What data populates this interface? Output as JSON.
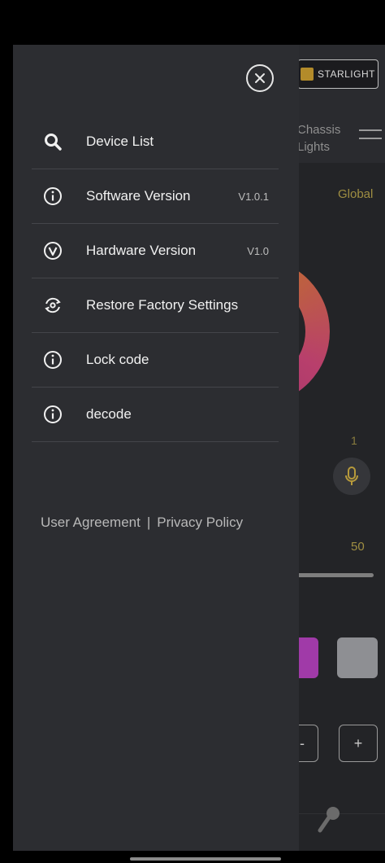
{
  "background_app": {
    "brand_label": "STARLIGHT",
    "tab_label_line1": "Chassis",
    "tab_label_line2": "Lights",
    "global_label": "Global",
    "value_1": "1",
    "value_50": "50",
    "minus_label": "-",
    "plus_label": "+",
    "colors": {
      "swatch_purple": "#a03aa8",
      "swatch_gray": "#8e8f93",
      "accent_gold": "#9f8e42"
    }
  },
  "drawer": {
    "close_icon": "close-circle-icon",
    "items": [
      {
        "icon": "search-icon",
        "label": "Device List",
        "version": ""
      },
      {
        "icon": "info-icon",
        "label": "Software Version",
        "version": "V1.0.1"
      },
      {
        "icon": "version-check-icon",
        "label": "Hardware Version",
        "version": "V1.0"
      },
      {
        "icon": "restore-icon",
        "label": "Restore Factory Settings",
        "version": ""
      },
      {
        "icon": "info-icon",
        "label": "Lock code",
        "version": ""
      },
      {
        "icon": "info-icon",
        "label": "decode",
        "version": ""
      }
    ],
    "user_agreement": "User Agreement",
    "separator": "|",
    "privacy_policy": "Privacy Policy"
  }
}
